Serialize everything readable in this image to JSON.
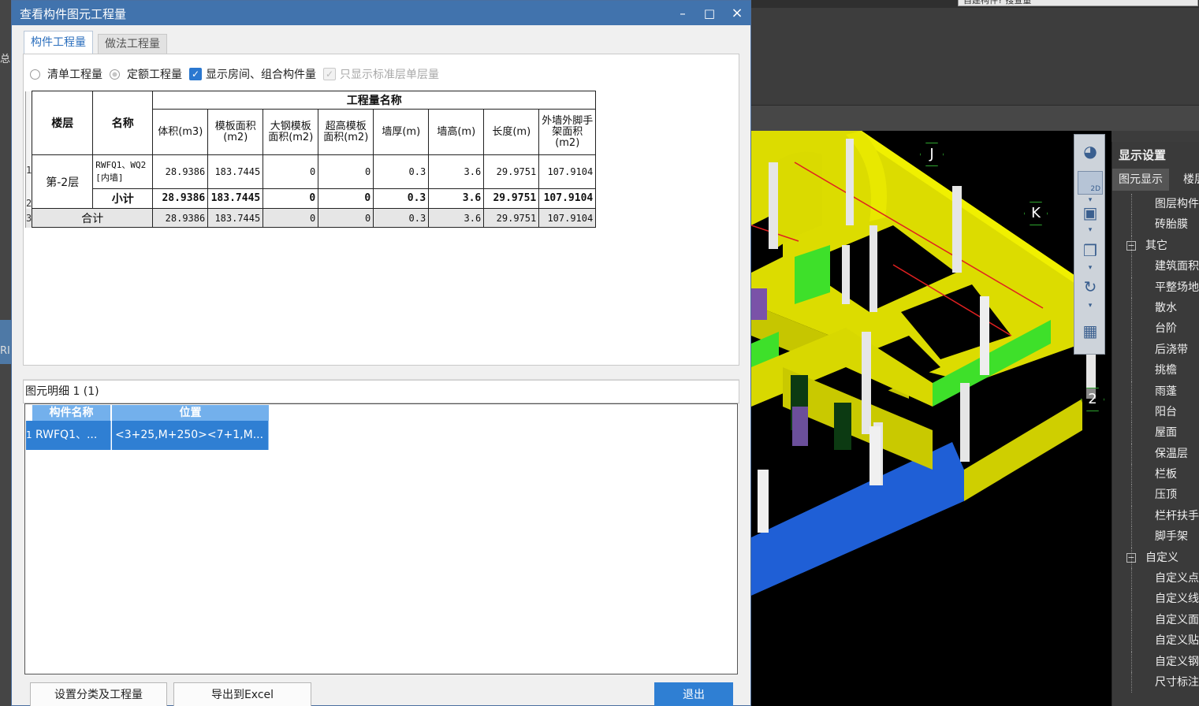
{
  "background": {
    "search_text": "自建构件? 搜查量",
    "left_labels": [
      "总",
      "RI"
    ],
    "axis_labels": [
      "J",
      "K",
      "2"
    ],
    "nav_labels": {
      "view_2d": "2D"
    },
    "display_panel": {
      "title": "显示设置",
      "tabs": [
        "图元显示",
        "楼层"
      ],
      "items": [
        {
          "label": "图层构件",
          "group": false
        },
        {
          "label": "砖胎膜",
          "group": false
        },
        {
          "label": "其它",
          "group": true
        },
        {
          "label": "建筑面积",
          "group": false
        },
        {
          "label": "平整场地",
          "group": false
        },
        {
          "label": "散水",
          "group": false
        },
        {
          "label": "台阶",
          "group": false
        },
        {
          "label": "后浇带",
          "group": false
        },
        {
          "label": "挑檐",
          "group": false
        },
        {
          "label": "雨蓬",
          "group": false
        },
        {
          "label": "阳台",
          "group": false
        },
        {
          "label": "屋面",
          "group": false
        },
        {
          "label": "保温层",
          "group": false
        },
        {
          "label": "栏板",
          "group": false
        },
        {
          "label": "压顶",
          "group": false
        },
        {
          "label": "栏杆扶手",
          "group": false
        },
        {
          "label": "脚手架",
          "group": false
        },
        {
          "label": "自定义",
          "group": true
        },
        {
          "label": "自定义点",
          "group": false
        },
        {
          "label": "自定义线",
          "group": false
        },
        {
          "label": "自定义面",
          "group": false
        },
        {
          "label": "自定义贴",
          "group": false
        },
        {
          "label": "自定义钢",
          "group": false
        },
        {
          "label": "尺寸标注",
          "group": false
        }
      ]
    }
  },
  "dialog": {
    "title": "查看构件图元工程量",
    "controls": {
      "minimize": "–",
      "maximize": "□",
      "close": "×"
    },
    "tabs": {
      "component_qty": "构件工程量",
      "method_qty": "做法工程量"
    },
    "options": {
      "bill_qty": "清单工程量",
      "quota_qty": "定额工程量",
      "show_room": "显示房间、组合构件量",
      "only_std": "只显示标准层单层量",
      "check_mark": "✓"
    },
    "table": {
      "head_floor": "楼层",
      "head_name": "名称",
      "head_group": "工程量名称",
      "columns": [
        "体积(m3)",
        "模板面积(m2)",
        "大钢模板面积(m2)",
        "超高模板面积(m2)",
        "墙厚(m)",
        "墙高(m)",
        "长度(m)",
        "外墙外脚手架面积(m2)"
      ],
      "row_indexes": [
        "1",
        "2",
        "3"
      ],
      "floor": "第-2层",
      "name": "RWFQ1、WQ2 [内墙]",
      "values": [
        "28.9386",
        "183.7445",
        "0",
        "0",
        "0.3",
        "3.6",
        "29.9751",
        "107.9104"
      ],
      "subtotal_label": "小计",
      "subtotal": [
        "28.9386",
        "183.7445",
        "0",
        "0",
        "0.3",
        "3.6",
        "29.9751",
        "107.9104"
      ],
      "total_label": "合计",
      "total": [
        "28.9386",
        "183.7445",
        "0",
        "0",
        "0.3",
        "3.6",
        "29.9751",
        "107.9104"
      ]
    },
    "detail": {
      "header": "图元明细  1 (1)",
      "columns": [
        "构件名称",
        "位置"
      ],
      "row_index": "1",
      "row": [
        "RWFQ1、...",
        "<3+25,M+250><7+1,M..."
      ]
    },
    "buttons": {
      "set_category": "设置分类及工程量",
      "export_excel": "导出到Excel",
      "exit": "退出"
    }
  }
}
